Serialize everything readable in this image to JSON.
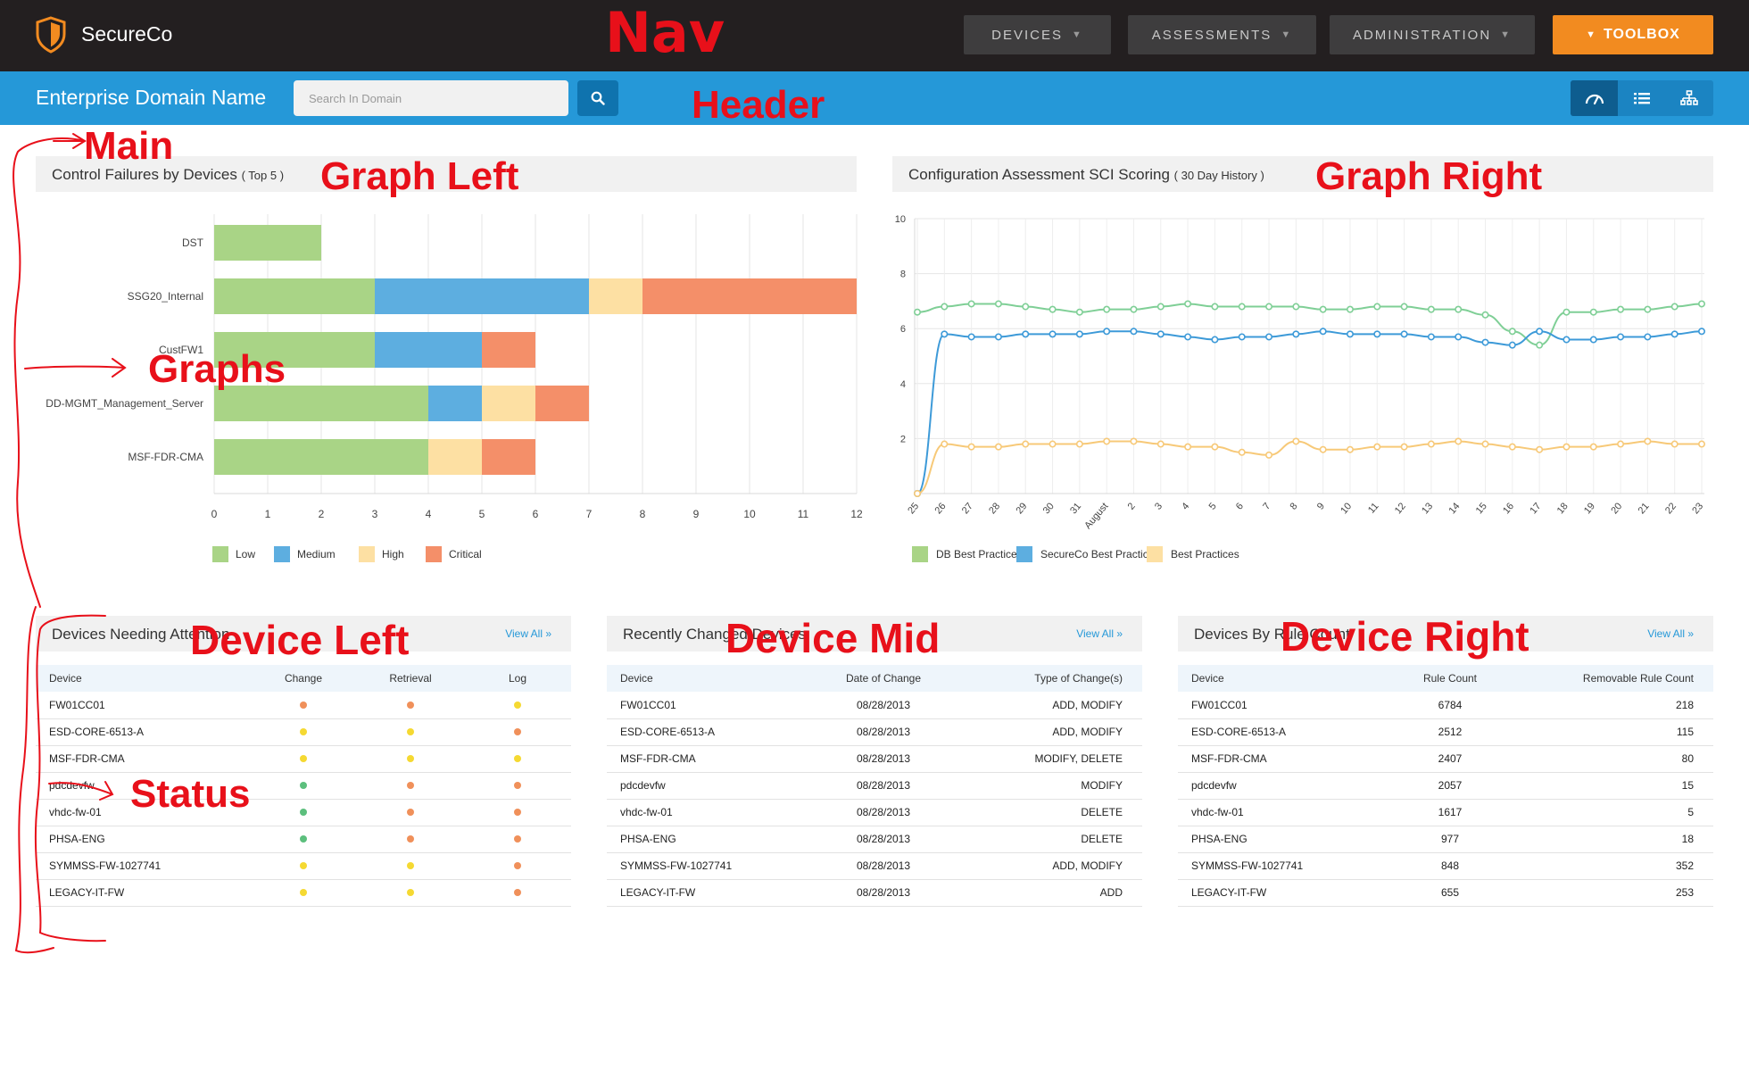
{
  "colors": {
    "nav_bg": "#231f20",
    "header_bg": "#2598d8",
    "accent": "#f28b20",
    "low": "#a9d486",
    "medium": "#5daee0",
    "high": "#fde0a3",
    "critical": "#f48f69",
    "status_orange": "#f0905a",
    "status_yellow": "#f5d932",
    "status_green": "#5cbf7d",
    "annotation": "#e8101a"
  },
  "nav": {
    "brand": "SecureCo",
    "logo_icon": "shield-logo-icon",
    "menus": [
      {
        "label": "DEVICES"
      },
      {
        "label": "ASSESSMENTS"
      },
      {
        "label": "ADMINISTRATION"
      }
    ],
    "toolbox_label": "TOOLBOX"
  },
  "header": {
    "domain_name": "Enterprise Domain Name",
    "search_placeholder": "Search In Domain",
    "view_icons": [
      "gauge-icon",
      "list-icon",
      "sitemap-icon"
    ]
  },
  "annotations": {
    "nav": "Nav",
    "header": "Header",
    "main": "Main",
    "graph_left": "Graph Left",
    "graph_right": "Graph Right",
    "graphs": "Graphs",
    "device_left": "Device Left",
    "device_mid": "Device Mid",
    "device_right": "Device Right",
    "status": "Status"
  },
  "graph_left": {
    "title": "Control Failures by Devices",
    "subtitle": "( Top 5 )"
  },
  "graph_right": {
    "title": "Configuration Assessment SCI Scoring",
    "subtitle": "( 30 Day History )"
  },
  "chart_data": [
    {
      "type": "bar",
      "orientation": "horizontal",
      "stacked": true,
      "categories": [
        "DST",
        "SSG20_Internal",
        "CustFW1",
        "DD-MGMT_Management_Server",
        "MSF-FDR-CMA"
      ],
      "series": [
        {
          "name": "Low",
          "color": "#a9d486",
          "values": [
            2,
            3,
            3,
            4,
            4
          ]
        },
        {
          "name": "Medium",
          "color": "#5daee0",
          "values": [
            0,
            4,
            2,
            1,
            0
          ]
        },
        {
          "name": "High",
          "color": "#fde0a3",
          "values": [
            0,
            1,
            0,
            1,
            1
          ]
        },
        {
          "name": "Critical",
          "color": "#f48f69",
          "values": [
            0,
            4,
            1,
            1,
            1
          ]
        }
      ],
      "xlim": [
        0,
        12
      ],
      "xticks": [
        "0",
        "1",
        "2",
        "3",
        "4",
        "5",
        "6",
        "7",
        "8",
        "9",
        "10",
        "11",
        "12"
      ],
      "grid": true,
      "legend": "bottom-left"
    },
    {
      "type": "line",
      "x": [
        "25",
        "26",
        "27",
        "28",
        "29",
        "30",
        "31",
        "August",
        "2",
        "3",
        "4",
        "5",
        "6",
        "7",
        "8",
        "9",
        "10",
        "11",
        "12",
        "13",
        "14",
        "15",
        "16",
        "17",
        "18",
        "19",
        "20",
        "21",
        "22",
        "23"
      ],
      "series": [
        {
          "name": "DB Best Practices",
          "color": "#7fcf96",
          "values": [
            6.6,
            6.8,
            6.9,
            6.9,
            6.8,
            6.7,
            6.6,
            6.7,
            6.7,
            6.8,
            6.9,
            6.8,
            6.8,
            6.8,
            6.8,
            6.7,
            6.7,
            6.8,
            6.8,
            6.7,
            6.7,
            6.5,
            5.9,
            5.4,
            6.6,
            6.6,
            6.7,
            6.7,
            6.8,
            6.9
          ]
        },
        {
          "name": "SecureCo Best Practices",
          "color": "#3d9ad8",
          "values": [
            0,
            5.8,
            5.7,
            5.7,
            5.8,
            5.8,
            5.8,
            5.9,
            5.9,
            5.8,
            5.7,
            5.6,
            5.7,
            5.7,
            5.8,
            5.9,
            5.8,
            5.8,
            5.8,
            5.7,
            5.7,
            5.5,
            5.4,
            5.9,
            5.6,
            5.6,
            5.7,
            5.7,
            5.8,
            5.9
          ]
        },
        {
          "name": "Best Practices",
          "color": "#f7c978",
          "values": [
            0,
            1.8,
            1.7,
            1.7,
            1.8,
            1.8,
            1.8,
            1.9,
            1.9,
            1.8,
            1.7,
            1.7,
            1.5,
            1.4,
            1.9,
            1.6,
            1.6,
            1.7,
            1.7,
            1.8,
            1.9,
            1.8,
            1.7,
            1.6,
            1.7,
            1.7,
            1.8,
            1.9,
            1.8,
            1.8
          ]
        }
      ],
      "ylim": [
        0,
        10
      ],
      "yticks": [
        "2",
        "4",
        "6",
        "8",
        "10"
      ],
      "grid": true,
      "legend": "bottom-left"
    }
  ],
  "device_left": {
    "title": "Devices Needing Attention",
    "view_all": "View All »",
    "columns": [
      "Device",
      "Change",
      "Retrieval",
      "Log"
    ],
    "rows": [
      {
        "device": "FW01CC01",
        "status": [
          "orange",
          "orange",
          "yellow"
        ]
      },
      {
        "device": "ESD-CORE-6513-A",
        "status": [
          "yellow",
          "yellow",
          "orange"
        ]
      },
      {
        "device": "MSF-FDR-CMA",
        "status": [
          "yellow",
          "yellow",
          "yellow"
        ]
      },
      {
        "device": "pdcdevfw",
        "status": [
          "green",
          "orange",
          "orange"
        ]
      },
      {
        "device": "vhdc-fw-01",
        "status": [
          "green",
          "orange",
          "orange"
        ]
      },
      {
        "device": "PHSA-ENG",
        "status": [
          "green",
          "orange",
          "orange"
        ]
      },
      {
        "device": "SYMMSS-FW-1027741",
        "status": [
          "yellow",
          "yellow",
          "orange"
        ]
      },
      {
        "device": "LEGACY-IT-FW",
        "status": [
          "yellow",
          "yellow",
          "orange"
        ]
      }
    ]
  },
  "device_mid": {
    "title": "Recently Changed Devices",
    "view_all": "View All »",
    "columns": [
      "Device",
      "Date of Change",
      "Type of Change(s)"
    ],
    "rows": [
      [
        "FW01CC01",
        "08/28/2013",
        "ADD, MODIFY"
      ],
      [
        "ESD-CORE-6513-A",
        "08/28/2013",
        "ADD, MODIFY"
      ],
      [
        "MSF-FDR-CMA",
        "08/28/2013",
        "MODIFY, DELETE"
      ],
      [
        "pdcdevfw",
        "08/28/2013",
        "MODIFY"
      ],
      [
        "vhdc-fw-01",
        "08/28/2013",
        "DELETE"
      ],
      [
        "PHSA-ENG",
        "08/28/2013",
        "DELETE"
      ],
      [
        "SYMMSS-FW-1027741",
        "08/28/2013",
        "ADD, MODIFY"
      ],
      [
        "LEGACY-IT-FW",
        "08/28/2013",
        "ADD"
      ]
    ]
  },
  "device_right": {
    "title": "Devices By Rule Count",
    "view_all": "View All »",
    "columns": [
      "Device",
      "Rule Count",
      "Removable Rule Count"
    ],
    "rows": [
      [
        "FW01CC01",
        "6784",
        "218"
      ],
      [
        "ESD-CORE-6513-A",
        "2512",
        "115"
      ],
      [
        "MSF-FDR-CMA",
        "2407",
        "80"
      ],
      [
        "pdcdevfw",
        "2057",
        "15"
      ],
      [
        "vhdc-fw-01",
        "1617",
        "5"
      ],
      [
        "PHSA-ENG",
        "977",
        "18"
      ],
      [
        "SYMMSS-FW-1027741",
        "848",
        "352"
      ],
      [
        "LEGACY-IT-FW",
        "655",
        "253"
      ]
    ]
  }
}
